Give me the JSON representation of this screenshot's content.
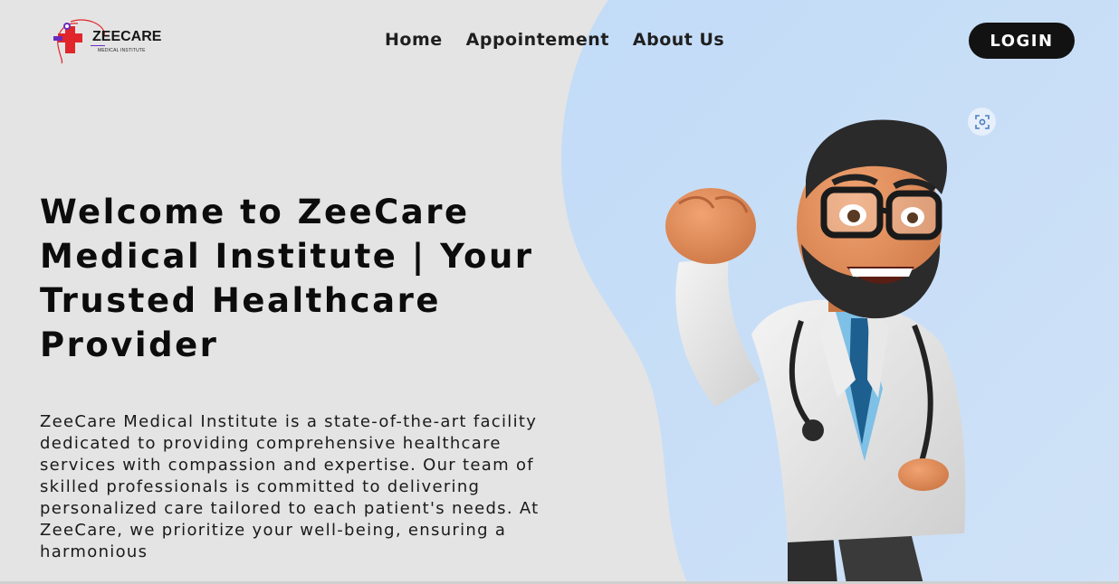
{
  "brand": {
    "name": "ZEECARE",
    "tagline": "MEDICAL INSTITUTE"
  },
  "nav": {
    "items": [
      {
        "label": "Home"
      },
      {
        "label": "Appointement"
      },
      {
        "label": "About Us"
      }
    ],
    "login_label": "LOGIN"
  },
  "hero": {
    "title": "Welcome to ZeeCare Medical Institute | Your Trusted Healthcare Provider",
    "description": "ZeeCare Medical Institute is a state-of-the-art facility dedicated to providing comprehensive healthcare services with compassion and expertise. Our team of skilled professionals is committed to delivering personalized care tailored to each patient's needs. At ZeeCare, we prioritize your well-being, ensuring a harmonious"
  },
  "colors": {
    "page_bg": "#e4e4e4",
    "blob": "#c5dcf6",
    "login_bg": "#121212",
    "logo_red": "#e0262b",
    "logo_purple": "#6a2bbf"
  },
  "icons": {
    "lens": "scan-lens-icon",
    "logo_cross": "medical-cross-icon"
  }
}
